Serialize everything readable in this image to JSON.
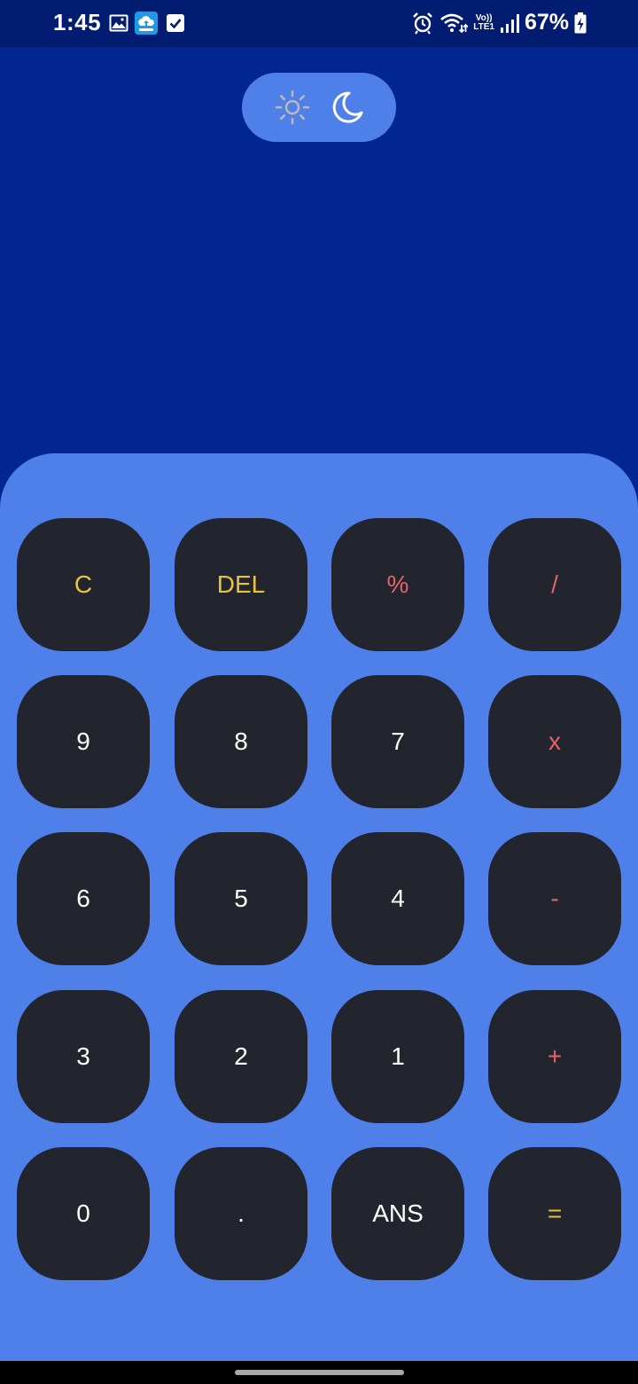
{
  "status_bar": {
    "time": "1:45",
    "battery": "67%",
    "network": "LTE1",
    "volte": "Vo))",
    "icons": [
      "gallery-icon",
      "cloud-upload-icon",
      "checkbox-icon",
      "alarm-icon",
      "wifi-icon",
      "signal-icon",
      "battery-charging-icon"
    ]
  },
  "theme_toggle": {
    "options": [
      "sun-icon",
      "moon-icon"
    ],
    "selected": "moon-icon"
  },
  "keypad": {
    "rows": [
      [
        {
          "label": "C",
          "color": "#e8c23a"
        },
        {
          "label": "DEL",
          "color": "#e8c23a"
        },
        {
          "label": "%",
          "color": "#e5626a"
        },
        {
          "label": "/",
          "color": "#e5626a"
        }
      ],
      [
        {
          "label": "9",
          "color": "#ffffff"
        },
        {
          "label": "8",
          "color": "#ffffff"
        },
        {
          "label": "7",
          "color": "#ffffff"
        },
        {
          "label": "x",
          "color": "#e5626a"
        }
      ],
      [
        {
          "label": "6",
          "color": "#ffffff"
        },
        {
          "label": "5",
          "color": "#ffffff"
        },
        {
          "label": "4",
          "color": "#ffffff"
        },
        {
          "label": "-",
          "color": "#e5626a"
        }
      ],
      [
        {
          "label": "3",
          "color": "#ffffff"
        },
        {
          "label": "2",
          "color": "#ffffff"
        },
        {
          "label": "1",
          "color": "#ffffff"
        },
        {
          "label": "+",
          "color": "#e5626a"
        }
      ],
      [
        {
          "label": "0",
          "color": "#ffffff"
        },
        {
          "label": ".",
          "color": "#ffffff"
        },
        {
          "label": "ANS",
          "color": "#ffffff"
        },
        {
          "label": "=",
          "color": "#e8c23a"
        }
      ]
    ]
  },
  "colors": {
    "background": "#022691",
    "status_bar": "#011c70",
    "panel": "#4f7fe8",
    "key": "#22252e",
    "accent_yellow": "#e8c23a",
    "accent_red": "#e5626a"
  }
}
